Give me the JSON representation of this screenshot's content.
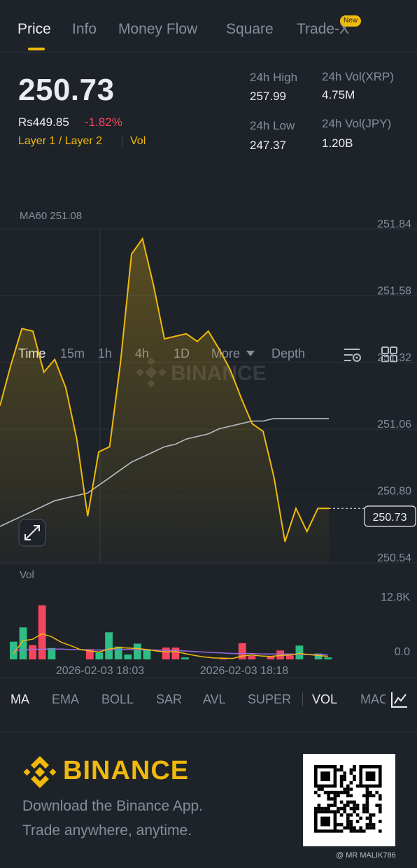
{
  "tabs": [
    {
      "label": "Price",
      "active": true
    },
    {
      "label": "Info",
      "active": false
    },
    {
      "label": "Money Flow",
      "active": false
    },
    {
      "label": "Square",
      "active": false
    },
    {
      "label": "Trade-X",
      "active": false
    }
  ],
  "new_badge": "New",
  "price": {
    "last": "250.73",
    "fiat": "Rs449.85",
    "change": "-1.82%",
    "tags": "Layer 1 / Layer 2",
    "vol_link": "Vol"
  },
  "stats": {
    "high_label": "24h High",
    "high_value": "257.99",
    "low_label": "24h Low",
    "low_value": "247.37",
    "vol_xrp_label": "24h Vol(XRP)",
    "vol_xrp_value": "4.75M",
    "vol_jpy_label": "24h Vol(JPY)",
    "vol_jpy_value": "1.20B"
  },
  "timeframes": [
    "Time",
    "15m",
    "1h",
    "4h",
    "1D",
    "More",
    "Depth"
  ],
  "chart_data": {
    "type": "area",
    "ma_legend": "MA60 251.08",
    "y_ticks": [
      "251.84",
      "251.58",
      "251.32",
      "251.06",
      "250.80",
      "250.54"
    ],
    "ylim": [
      250.54,
      251.84
    ],
    "current_price_tag": "250.73",
    "watermark": "BINANCE",
    "x_labels": [
      "2026-02-03 18:03",
      "2026-02-03 18:18"
    ],
    "price_series": [
      251.13,
      251.29,
      251.43,
      251.42,
      251.26,
      251.31,
      251.2,
      251.0,
      250.7,
      250.95,
      250.97,
      251.3,
      251.72,
      251.78,
      251.6,
      251.39,
      251.4,
      251.41,
      251.38,
      251.42,
      251.35,
      251.27,
      251.16,
      251.06,
      251.03,
      250.85,
      250.6,
      250.73,
      250.64,
      250.73,
      250.73
    ],
    "ma60_series": [
      250.66,
      250.68,
      250.7,
      250.72,
      250.74,
      250.76,
      250.77,
      250.78,
      250.79,
      250.82,
      250.85,
      250.88,
      250.91,
      250.93,
      250.95,
      250.97,
      250.98,
      251.0,
      251.01,
      251.02,
      251.04,
      251.05,
      251.06,
      251.07,
      251.07,
      251.08,
      251.08,
      251.08,
      251.08,
      251.08,
      251.08
    ],
    "volume": {
      "label": "Vol",
      "y_ticks": [
        "12.8K",
        "0.0"
      ],
      "ylim": [
        0,
        12800
      ],
      "bars": [
        {
          "v": 3600,
          "up": true
        },
        {
          "v": 6500,
          "up": true
        },
        {
          "v": 2900,
          "up": false
        },
        {
          "v": 11000,
          "up": false
        },
        {
          "v": 2300,
          "up": true
        },
        {
          "v": 0,
          "up": true
        },
        {
          "v": 0,
          "up": true
        },
        {
          "v": 0,
          "up": true
        },
        {
          "v": 2100,
          "up": false
        },
        {
          "v": 1400,
          "up": true
        },
        {
          "v": 5500,
          "up": true
        },
        {
          "v": 2600,
          "up": true
        },
        {
          "v": 1000,
          "up": true
        },
        {
          "v": 3200,
          "up": true
        },
        {
          "v": 2100,
          "up": true
        },
        {
          "v": 0,
          "up": true
        },
        {
          "v": 2400,
          "up": false
        },
        {
          "v": 2400,
          "up": false
        },
        {
          "v": 400,
          "up": true
        },
        {
          "v": 0,
          "up": true
        },
        {
          "v": 0,
          "up": true
        },
        {
          "v": 0,
          "up": true
        },
        {
          "v": 300,
          "up": false
        },
        {
          "v": 0,
          "up": true
        },
        {
          "v": 3300,
          "up": false
        },
        {
          "v": 700,
          "up": false
        },
        {
          "v": 0,
          "up": true
        },
        {
          "v": 700,
          "up": false
        },
        {
          "v": 1800,
          "up": false
        },
        {
          "v": 800,
          "up": false
        },
        {
          "v": 2800,
          "up": true
        },
        {
          "v": 0,
          "up": true
        },
        {
          "v": 1200,
          "up": true
        },
        {
          "v": 400,
          "up": true
        }
      ],
      "ma_short": [
        1200,
        3800,
        4100,
        5200,
        4600,
        3500,
        2800,
        2000,
        1700,
        1500,
        2100,
        2400,
        2300,
        2200,
        2000,
        1700,
        1500,
        1600,
        1200,
        800,
        500,
        300,
        250,
        200,
        700,
        900,
        700,
        600,
        800,
        900,
        1200,
        1000,
        800,
        600
      ],
      "ma_long": [
        1800,
        1900,
        2000,
        2100,
        2100,
        2100,
        2000,
        2000,
        1900,
        1900,
        1900,
        2000,
        2000,
        2000,
        1900,
        1900,
        1800,
        1800,
        1700,
        1600,
        1500,
        1400,
        1300,
        1200,
        1200,
        1200,
        1100,
        1100,
        1100,
        1100,
        1000,
        1000,
        1000,
        900
      ]
    }
  },
  "indicators": [
    {
      "label": "MA",
      "active": true
    },
    {
      "label": "EMA",
      "active": false
    },
    {
      "label": "BOLL",
      "active": false
    },
    {
      "label": "SAR",
      "active": false
    },
    {
      "label": "AVL",
      "active": false
    },
    {
      "label": "SUPER",
      "active": false
    },
    {
      "label": "VOL",
      "active": true
    },
    {
      "label": "MAC",
      "active": false
    }
  ],
  "footer": {
    "brand": "BINANCE",
    "promo_line1": "Download the Binance App.",
    "promo_line2": "Trade anywhere, anytime.",
    "watermark_user": "@ MR MALIK786"
  },
  "colors": {
    "accent": "#f0b90b",
    "up": "#2ebd85",
    "down": "#f6465d",
    "ma60": "#b7bdc6",
    "vol_ma_short": "#f0b90b",
    "vol_ma_long": "#9c6ade"
  }
}
